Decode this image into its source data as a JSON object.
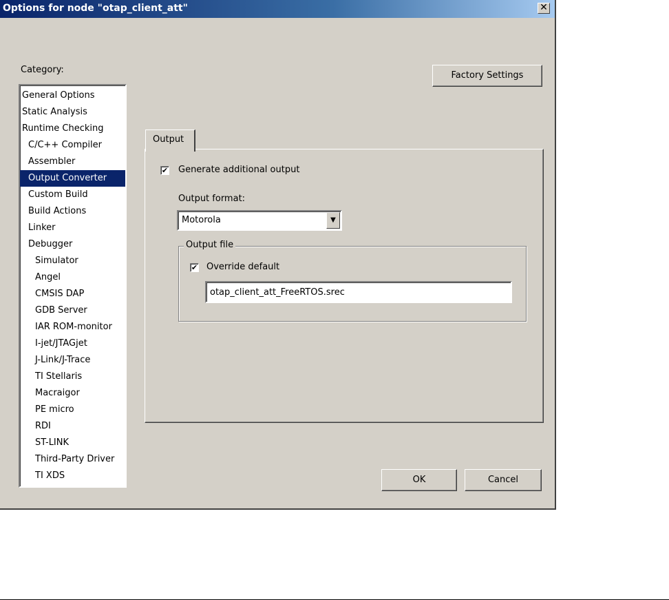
{
  "window": {
    "title": "Options for node \"otap_client_att\"",
    "close_glyph": "✕"
  },
  "category": {
    "label": "Category:",
    "items": [
      {
        "label": "General Options",
        "indent": 0
      },
      {
        "label": "Static Analysis",
        "indent": 0
      },
      {
        "label": "Runtime Checking",
        "indent": 0
      },
      {
        "label": "C/C++ Compiler",
        "indent": 1
      },
      {
        "label": "Assembler",
        "indent": 1
      },
      {
        "label": "Output Converter",
        "indent": 1,
        "selected": true
      },
      {
        "label": "Custom Build",
        "indent": 1
      },
      {
        "label": "Build Actions",
        "indent": 1
      },
      {
        "label": "Linker",
        "indent": 1
      },
      {
        "label": "Debugger",
        "indent": 1
      },
      {
        "label": "Simulator",
        "indent": 2
      },
      {
        "label": "Angel",
        "indent": 2
      },
      {
        "label": "CMSIS DAP",
        "indent": 2
      },
      {
        "label": "GDB Server",
        "indent": 2
      },
      {
        "label": "IAR ROM-monitor",
        "indent": 2
      },
      {
        "label": "I-jet/JTAGjet",
        "indent": 2
      },
      {
        "label": "J-Link/J-Trace",
        "indent": 2
      },
      {
        "label": "TI Stellaris",
        "indent": 2
      },
      {
        "label": "Macraigor",
        "indent": 2
      },
      {
        "label": "PE micro",
        "indent": 2
      },
      {
        "label": "RDI",
        "indent": 2
      },
      {
        "label": "ST-LINK",
        "indent": 2
      },
      {
        "label": "Third-Party Driver",
        "indent": 2
      },
      {
        "label": "TI XDS",
        "indent": 2
      }
    ]
  },
  "buttons": {
    "factory_settings": "Factory Settings",
    "ok": "OK",
    "cancel": "Cancel"
  },
  "tabs": [
    {
      "label": "Output",
      "active": true
    }
  ],
  "output": {
    "generate_additional_output": {
      "label": "Generate additional output",
      "checked": true
    },
    "format_label": "Output format:",
    "format_value": "Motorola",
    "file_group_title": "Output file",
    "override_default": {
      "label": "Override default",
      "checked": true
    },
    "file_name": "otap_client_att_FreeRTOS.srec"
  },
  "icons": {
    "checkmark": "✔",
    "dropdown_arrow": "▼"
  },
  "colors": {
    "dialog_face": "#d4d0c8",
    "titlebar_start": "#0a246a",
    "selection": "#0a246a"
  }
}
